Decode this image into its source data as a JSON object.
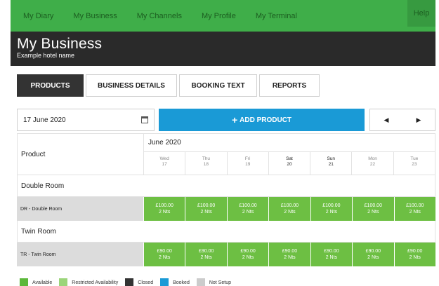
{
  "topnav": {
    "items": [
      "My Diary",
      "My Business",
      "My Channels",
      "My Profile",
      "My Terminal"
    ],
    "help": "Help"
  },
  "header": {
    "title": "My Business",
    "subtitle": "Example hotel name"
  },
  "tabs": [
    "PRODUCTS",
    "BUSINESS DETAILS",
    "BOOKING TEXT",
    "REPORTS"
  ],
  "toolbar": {
    "date_value": "17 June 2020",
    "add_label": "ADD PRODUCT",
    "prev_label": "◀",
    "next_label": "▶"
  },
  "grid": {
    "product_header": "Product",
    "month": "June 2020",
    "days": [
      {
        "dow": "Wed",
        "num": "17"
      },
      {
        "dow": "Thu",
        "num": "18"
      },
      {
        "dow": "Fri",
        "num": "19"
      },
      {
        "dow": "Sat",
        "num": "20"
      },
      {
        "dow": "Sun",
        "num": "21"
      },
      {
        "dow": "Mon",
        "num": "22"
      },
      {
        "dow": "Tue",
        "num": "23"
      }
    ],
    "groups": [
      {
        "name": "Double Room",
        "product": "DR - Double Room",
        "cells": [
          {
            "price": "£100.00",
            "nights": "2 Nts"
          },
          {
            "price": "£100.00",
            "nights": "2 Nts"
          },
          {
            "price": "£100.00",
            "nights": "2 Nts"
          },
          {
            "price": "£100.00",
            "nights": "2 Nts"
          },
          {
            "price": "£100.00",
            "nights": "2 Nts"
          },
          {
            "price": "£100.00",
            "nights": "2 Nts"
          },
          {
            "price": "£100.00",
            "nights": "2 Nts"
          }
        ]
      },
      {
        "name": "Twin Room",
        "product": "TR - Twin Room",
        "cells": [
          {
            "price": "£90.00",
            "nights": "2 Nts"
          },
          {
            "price": "£90.00",
            "nights": "2 Nts"
          },
          {
            "price": "£90.00",
            "nights": "2 Nts"
          },
          {
            "price": "£90.00",
            "nights": "2 Nts"
          },
          {
            "price": "£90.00",
            "nights": "2 Nts"
          },
          {
            "price": "£90.00",
            "nights": "2 Nts"
          },
          {
            "price": "£90.00",
            "nights": "2 Nts"
          }
        ]
      }
    ]
  },
  "legend": [
    {
      "label": "Available",
      "color": "#5cb83a"
    },
    {
      "label": "Restricted Availability",
      "color": "#9bd57a"
    },
    {
      "label": "Closed",
      "color": "#333333"
    },
    {
      "label": "Booked",
      "color": "#1a9ad6"
    },
    {
      "label": "Not Setup",
      "color": "#cccccc"
    }
  ],
  "colors": {
    "nav": "#3fae49",
    "header": "#2a2a2a",
    "accent": "#1a9ad6",
    "available": "#6dbf43"
  },
  "icons": {
    "calendar": "calendar-icon",
    "add": "plus-icon",
    "prev": "chevron-left-icon",
    "next": "chevron-right-icon"
  }
}
